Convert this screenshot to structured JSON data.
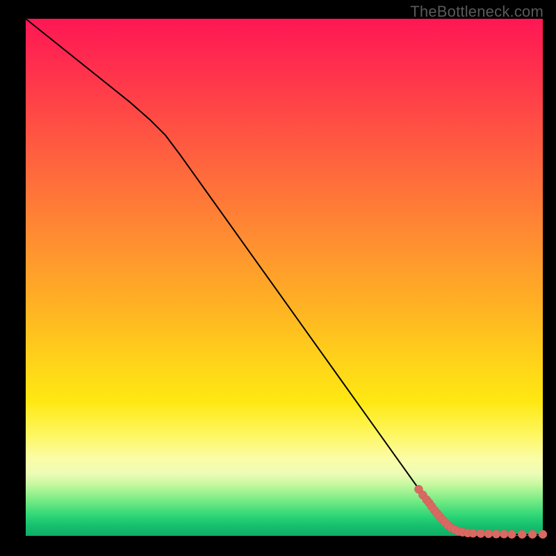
{
  "watermark": "TheBottleneck.com",
  "chart_data": {
    "type": "line",
    "title": "",
    "xlabel": "",
    "ylabel": "",
    "xlim": [
      0,
      100
    ],
    "ylim": [
      0,
      100
    ],
    "grid": false,
    "legend": false,
    "axes_hidden": true,
    "background": "red-yellow-green vertical gradient (red top, green bottom)",
    "series": [
      {
        "name": "curve",
        "style": "solid black line",
        "points_xy": [
          [
            0,
            100.0
          ],
          [
            5,
            96.0
          ],
          [
            10,
            92.0
          ],
          [
            15,
            88.0
          ],
          [
            20,
            84.0
          ],
          [
            24,
            80.5
          ],
          [
            27,
            77.5
          ],
          [
            30,
            73.5
          ],
          [
            35,
            66.5
          ],
          [
            40,
            59.5
          ],
          [
            45,
            52.5
          ],
          [
            50,
            45.5
          ],
          [
            55,
            38.5
          ],
          [
            60,
            31.5
          ],
          [
            65,
            24.5
          ],
          [
            70,
            17.5
          ],
          [
            75,
            10.5
          ],
          [
            78,
            6.3
          ],
          [
            80,
            3.8
          ],
          [
            82,
            2.0
          ],
          [
            84,
            1.0
          ],
          [
            86,
            0.5
          ],
          [
            90,
            0.3
          ],
          [
            95,
            0.25
          ],
          [
            100,
            0.2
          ]
        ]
      },
      {
        "name": "scatter-points",
        "style": "salmon/coral filled circles",
        "points_xy": [
          [
            76.0,
            9.0
          ],
          [
            76.8,
            7.9
          ],
          [
            77.5,
            7.0
          ],
          [
            78.0,
            6.4
          ],
          [
            78.5,
            5.7
          ],
          [
            79.0,
            5.0
          ],
          [
            79.5,
            4.4
          ],
          [
            80.0,
            3.8
          ],
          [
            80.6,
            3.1
          ],
          [
            81.1,
            2.6
          ],
          [
            81.7,
            2.0
          ],
          [
            82.3,
            1.55
          ],
          [
            83.0,
            1.2
          ],
          [
            83.7,
            0.9
          ],
          [
            84.5,
            0.7
          ],
          [
            85.5,
            0.55
          ],
          [
            86.5,
            0.5
          ],
          [
            88.0,
            0.45
          ],
          [
            89.5,
            0.4
          ],
          [
            91.0,
            0.35
          ],
          [
            92.5,
            0.35
          ],
          [
            94.0,
            0.3
          ],
          [
            96.0,
            0.3
          ],
          [
            98.0,
            0.3
          ],
          [
            100.0,
            0.3
          ]
        ]
      }
    ]
  }
}
